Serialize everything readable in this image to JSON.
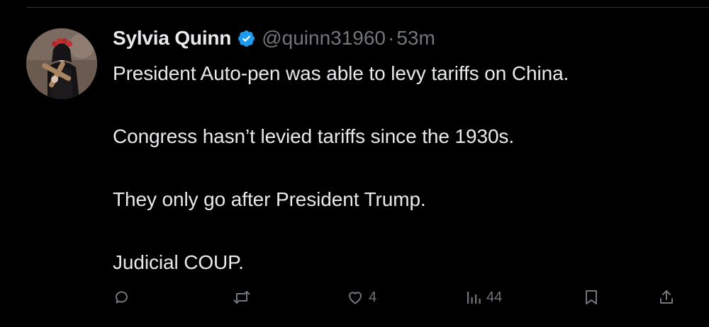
{
  "tweet": {
    "author": {
      "display_name": "Sylvia Quinn",
      "handle": "@quinn31960",
      "verified": true,
      "verified_color": "#1d9bf0"
    },
    "separator": "·",
    "timestamp": "53m",
    "lines": [
      "President Auto-pen was able to levy tariffs on China.",
      "Congress hasn’t levied tariffs since the 1930s.",
      "They only go after President Trump.",
      "Judicial COUP."
    ]
  },
  "actions": {
    "reply": {
      "icon": "reply-icon",
      "count": ""
    },
    "retweet": {
      "icon": "retweet-icon",
      "count": ""
    },
    "like": {
      "icon": "heart-icon",
      "count": "4"
    },
    "views": {
      "icon": "views-icon",
      "count": "44"
    },
    "bookmark": {
      "icon": "bookmark-icon",
      "count": ""
    },
    "share": {
      "icon": "share-icon",
      "count": ""
    }
  },
  "colors": {
    "background": "#000000",
    "text": "#e7e9ea",
    "muted": "#71767b",
    "divider": "#2f3336"
  }
}
